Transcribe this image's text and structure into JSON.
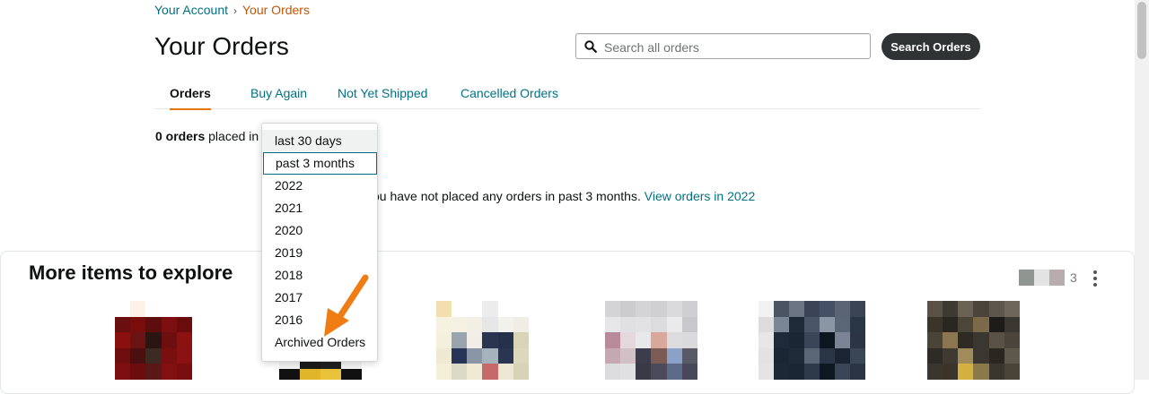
{
  "breadcrumb": {
    "parent": "Your Account",
    "separator": "›",
    "current": "Your Orders"
  },
  "page_title": "Your Orders",
  "search": {
    "placeholder": "Search all orders",
    "value": "",
    "button_label": "Search Orders"
  },
  "tabs": [
    {
      "label": "Orders",
      "active": true
    },
    {
      "label": "Buy Again",
      "active": false
    },
    {
      "label": "Not Yet Shipped",
      "active": false
    },
    {
      "label": "Cancelled Orders",
      "active": false
    }
  ],
  "orders_summary": {
    "count_text": "0 orders",
    "suffix": "placed in"
  },
  "filter_dropdown": {
    "selected": "past 3 months",
    "options": [
      "last 30 days",
      "past 3 months",
      "2022",
      "2021",
      "2020",
      "2019",
      "2018",
      "2017",
      "2016",
      "Archived Orders"
    ]
  },
  "empty_state": {
    "message": "ou have not placed any orders in past 3 months.",
    "link": "View orders in 2022"
  },
  "explore": {
    "title": "More items to explore",
    "page_number": "3"
  },
  "colors": {
    "link": "#007185",
    "active_tab_underline": "#e77600",
    "breadcrumb_current": "#c45500",
    "search_button": "#303333",
    "annotation_arrow": "#f07c14"
  },
  "icons": {
    "search": "search-icon",
    "more": "more-vertical-icon",
    "arrow": "annotation-arrow-icon"
  }
}
